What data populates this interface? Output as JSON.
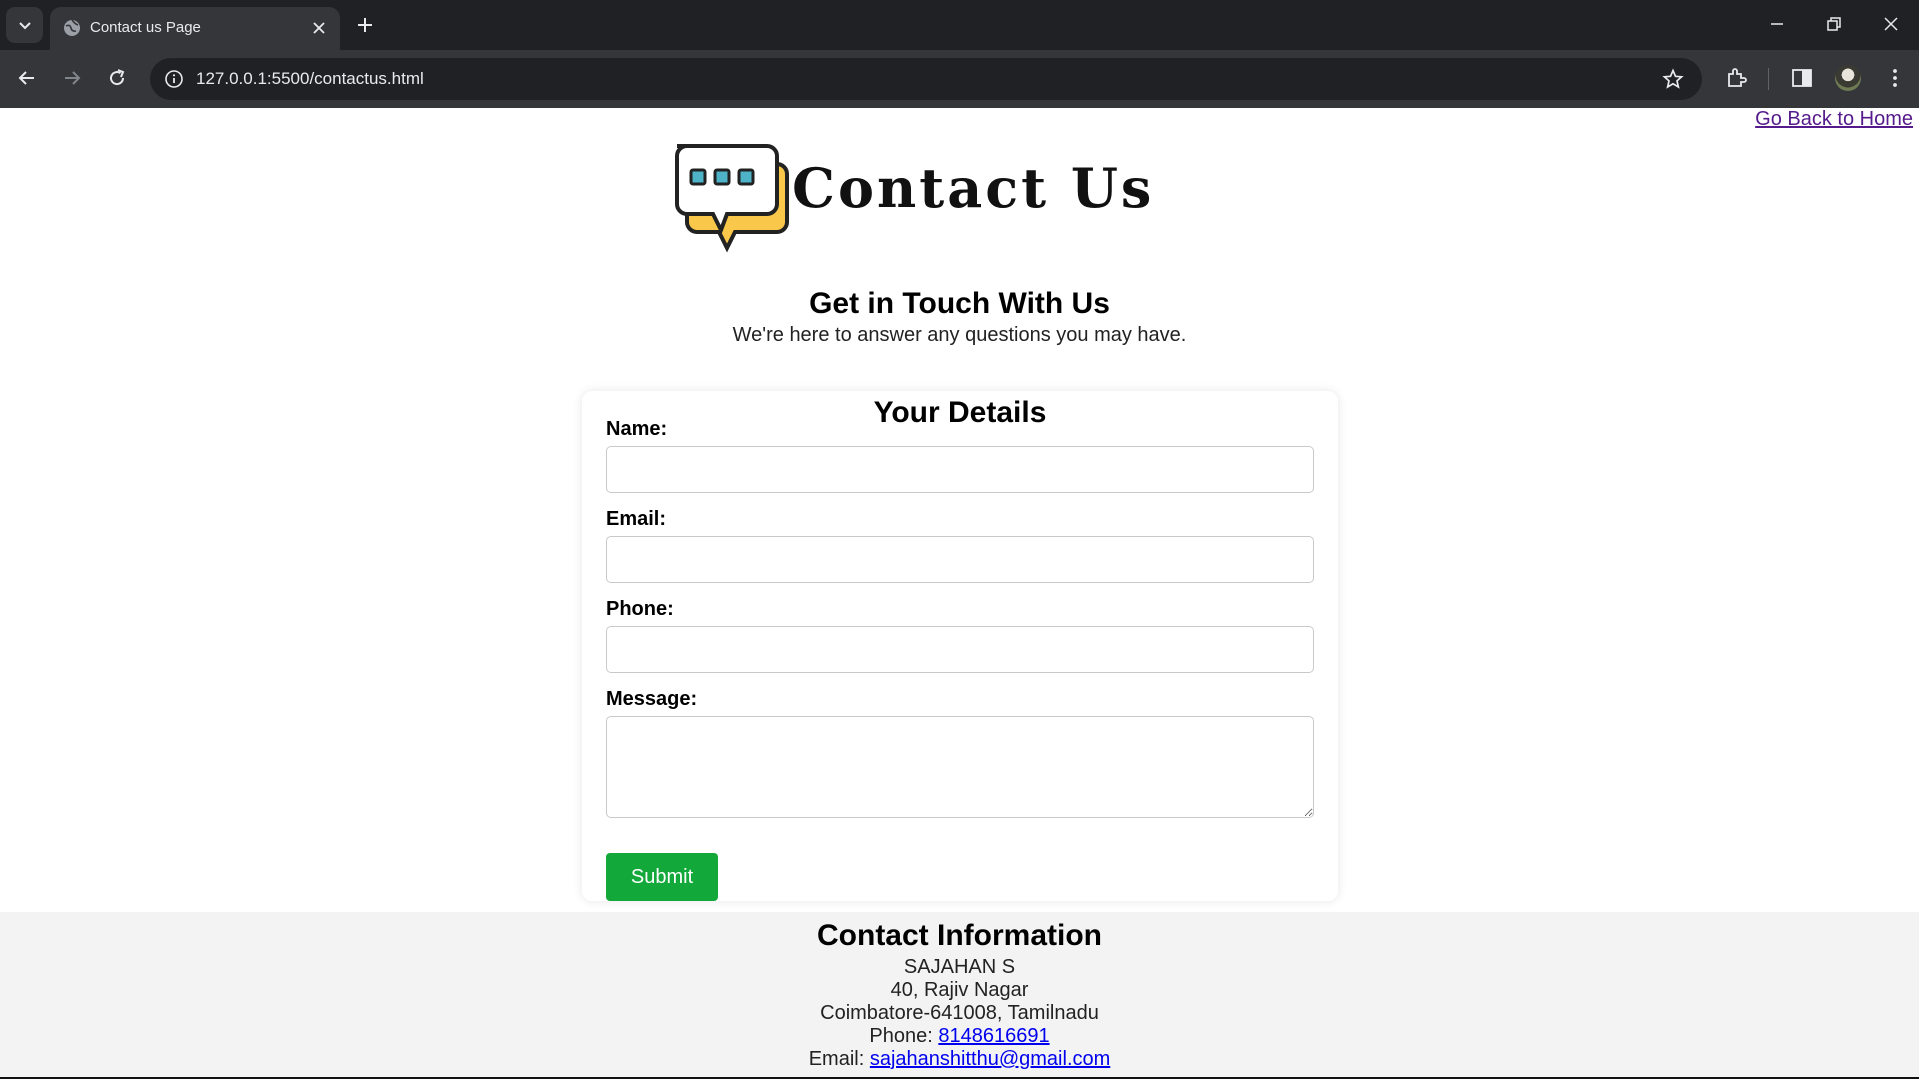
{
  "browser": {
    "tab_title": "Contact us Page",
    "url": "127.0.0.1:5500/contactus.html"
  },
  "page": {
    "home_link": "Go Back to Home",
    "logo_text": "Contact Us",
    "heading": "Get in Touch With Us",
    "subheading": "We're here to answer any questions you may have.",
    "form": {
      "title": "Your Details",
      "name_label": "Name:",
      "name_value": "",
      "email_label": "Email:",
      "email_value": "",
      "phone_label": "Phone:",
      "phone_value": "",
      "message_label": "Message:",
      "message_value": "",
      "submit_label": "Submit"
    },
    "contact": {
      "title": "Contact Information",
      "name": "SAJAHAN S",
      "address_line1": "40, Rajiv Nagar",
      "address_line2": "Coimbatore-641008, Tamilnadu",
      "phone_prefix": "Phone:",
      "phone": "8148616691",
      "email_prefix": "Email:",
      "email": "sajahanshitthu@gmail.com"
    }
  },
  "colors": {
    "submit_button": "#13a83a",
    "logo_bubble": "#f9c84a",
    "logo_dots": "#4fb3c8",
    "visited_link": "#551a8b",
    "link": "#0000ee"
  },
  "icons": [
    "tab-search-icon",
    "globe-icon",
    "close-icon",
    "plus-icon",
    "minimize-icon",
    "restore-icon",
    "back-arrow-icon",
    "forward-arrow-icon",
    "reload-icon",
    "site-info-icon",
    "star-icon",
    "extensions-icon",
    "side-panel-icon",
    "more-vert-icon",
    "chat-bubble-icon"
  ]
}
